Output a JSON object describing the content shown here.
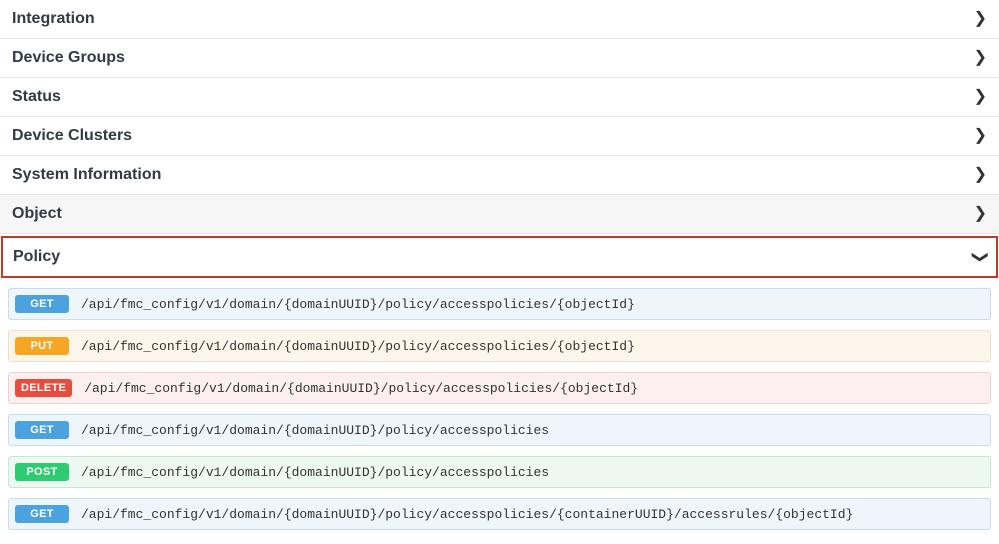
{
  "sections": {
    "integration": {
      "title": "Integration"
    },
    "device_groups": {
      "title": "Device Groups"
    },
    "status": {
      "title": "Status"
    },
    "device_clusters": {
      "title": "Device Clusters"
    },
    "system_info": {
      "title": "System Information"
    },
    "object": {
      "title": "Object"
    },
    "policy": {
      "title": "Policy"
    }
  },
  "methods": {
    "get": "GET",
    "put": "PUT",
    "delete": "DELETE",
    "post": "POST"
  },
  "endpoints": [
    {
      "method": "GET",
      "path": "/api/fmc_config/v1/domain/{domainUUID}/policy/accesspolicies/{objectId}"
    },
    {
      "method": "PUT",
      "path": "/api/fmc_config/v1/domain/{domainUUID}/policy/accesspolicies/{objectId}"
    },
    {
      "method": "DELETE",
      "path": "/api/fmc_config/v1/domain/{domainUUID}/policy/accesspolicies/{objectId}"
    },
    {
      "method": "GET",
      "path": "/api/fmc_config/v1/domain/{domainUUID}/policy/accesspolicies"
    },
    {
      "method": "POST",
      "path": "/api/fmc_config/v1/domain/{domainUUID}/policy/accesspolicies"
    },
    {
      "method": "GET",
      "path": "/api/fmc_config/v1/domain/{domainUUID}/policy/accesspolicies/{containerUUID}/accessrules/{objectId}"
    }
  ]
}
